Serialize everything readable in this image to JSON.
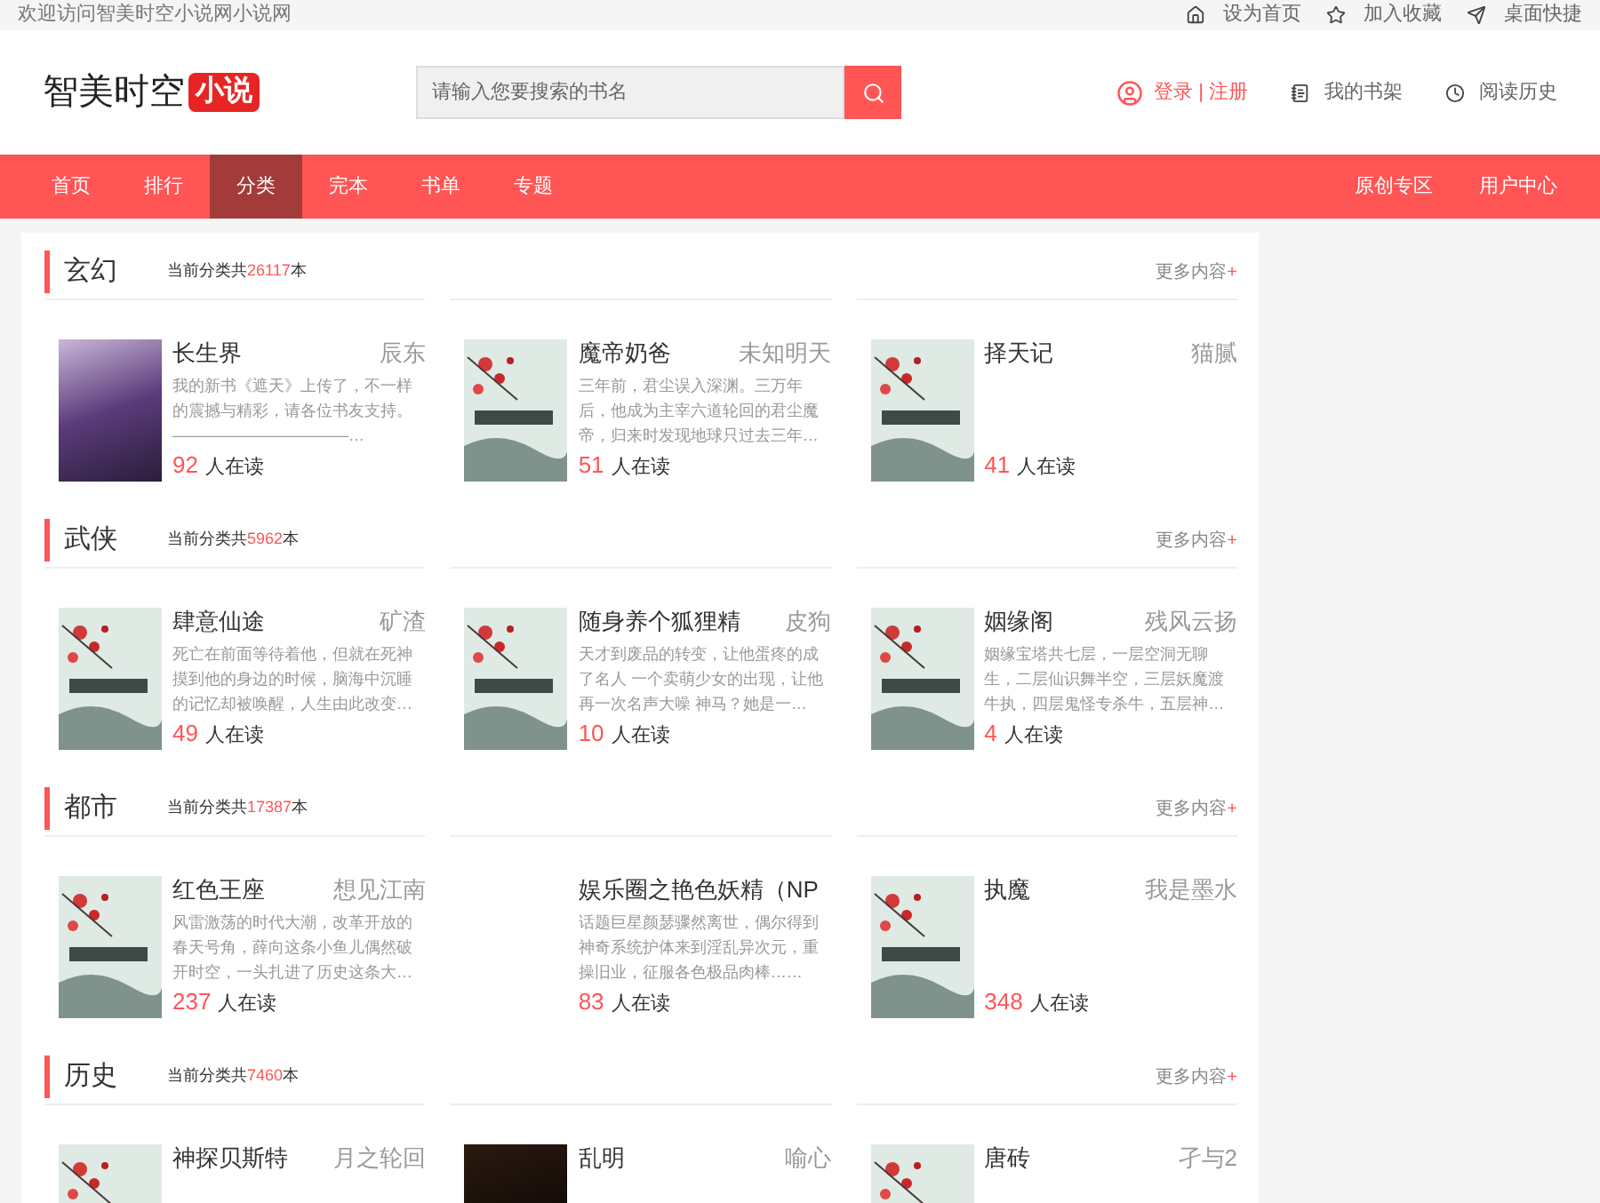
{
  "top_bar": {
    "welcome": "欢迎访问智美时空小说网小说网",
    "links": [
      {
        "kind": "home",
        "label": "设为首页"
      },
      {
        "kind": "star",
        "label": "加入收藏"
      },
      {
        "kind": "send",
        "label": "桌面快捷"
      }
    ]
  },
  "header": {
    "logo_text": "智美时空",
    "logo_badge": "小说",
    "search": {
      "placeholder": "请输入您要搜索的书名"
    },
    "login": "登录",
    "separator": "|",
    "register": "注册",
    "links": [
      {
        "kind": "book",
        "label": "我的书架"
      },
      {
        "kind": "clock",
        "label": "阅读历史"
      }
    ]
  },
  "nav": {
    "items": [
      {
        "label": "首页",
        "selected": false
      },
      {
        "label": "排行",
        "selected": false
      },
      {
        "label": "分类",
        "selected": true
      },
      {
        "label": "完本",
        "selected": false
      },
      {
        "label": "书单",
        "selected": false
      },
      {
        "label": "专题",
        "selected": false
      }
    ],
    "right_items": [
      "原创专区",
      "用户中心"
    ]
  },
  "sections": [
    {
      "title": "玄幻",
      "count_prefix": "当前分类共",
      "count": "26117",
      "count_suffix": "本",
      "more": "更多内容",
      "more_plus": "+",
      "books": [
        {
          "cover": {
            "kind": "photo"
          },
          "title": "长生界",
          "author": "辰东",
          "description": "我的新书《遮天》上传了，不一样的震撼与精彩，请各位书友支持。———————————…",
          "readers": "92",
          "readers_label": "人在读"
        },
        {
          "cover": {
            "kind": "placeholder"
          },
          "title": "魔帝奶爸",
          "author": "未知明天",
          "description": "三年前，君尘误入深渊。三万年后，他成为主宰六道轮回的君尘魔帝，归来时发现地球只过去三年…",
          "readers": "51",
          "readers_label": "人在读"
        },
        {
          "cover": {
            "kind": "placeholder"
          },
          "title": "择天记",
          "author": "猫腻",
          "readers": "41",
          "readers_label": "人在读"
        }
      ]
    },
    {
      "title": "武侠",
      "count_prefix": "当前分类共",
      "count": "5962",
      "count_suffix": "本",
      "more": "更多内容",
      "more_plus": "+",
      "books": [
        {
          "cover": {
            "kind": "placeholder"
          },
          "title": "肆意仙途",
          "author": "矿渣",
          "description": "死亡在前面等待着他，但就在死神摸到他的身边的时候，脑海中沉睡的记忆却被唤醒，人生由此改变…",
          "readers": "49",
          "readers_label": "人在读"
        },
        {
          "cover": {
            "kind": "placeholder"
          },
          "title": "随身养个狐狸精",
          "author": "皮狗",
          "description": "天才到废品的转变，让他蛋疼的成了名人 一个卖萌少女的出现，让他再一次名声大噪 神马？她是一…",
          "readers": "10",
          "readers_label": "人在读"
        },
        {
          "cover": {
            "kind": "placeholder"
          },
          "title": "姻缘阁",
          "author": "残风云扬",
          "description": "姻缘宝塔共七层，一层空洞无聊生，二层仙识舞半空，三层妖魔渡牛执，四层鬼怪专杀牛，五层神…",
          "readers": "4",
          "readers_label": "人在读"
        }
      ]
    },
    {
      "title": "都市",
      "count_prefix": "当前分类共",
      "count": "17387",
      "count_suffix": "本",
      "more": "更多内容",
      "more_plus": "+",
      "books": [
        {
          "cover": {
            "kind": "placeholder"
          },
          "title": "红色王座",
          "author": "想见江南",
          "description": "风雷激荡的时代大潮，改革开放的春天号角，薛向这条小鱼儿偶然破开时空，一头扎进了历史这条大…",
          "readers": "237",
          "readers_label": "人在读"
        },
        {
          "cover": {
            "kind": "none"
          },
          "title": "娱乐圈之艳色妖精（NP",
          "description": "话题巨星颜瑟骤然离世，偶尔得到神奇系统护体来到淫乱异次元，重操旧业，征服各色极品肉棒……",
          "readers": "83",
          "readers_label": "人在读"
        },
        {
          "cover": {
            "kind": "placeholder"
          },
          "title": "执魔",
          "author": "我是墨水",
          "readers": "348",
          "readers_label": "人在读"
        }
      ]
    },
    {
      "title": "历史",
      "count_prefix": "当前分类共",
      "count": "7460",
      "count_suffix": "本",
      "more": "更多内容",
      "more_plus": "+",
      "books": [
        {
          "cover": {
            "kind": "placeholder"
          },
          "title": "神探贝斯特",
          "author": "月之轮回"
        },
        {
          "cover": {
            "kind": "dark"
          },
          "title": "乱明",
          "author": "喻心"
        },
        {
          "cover": {
            "kind": "placeholder"
          },
          "title": "唐砖",
          "author": "孑与2"
        }
      ]
    }
  ]
}
